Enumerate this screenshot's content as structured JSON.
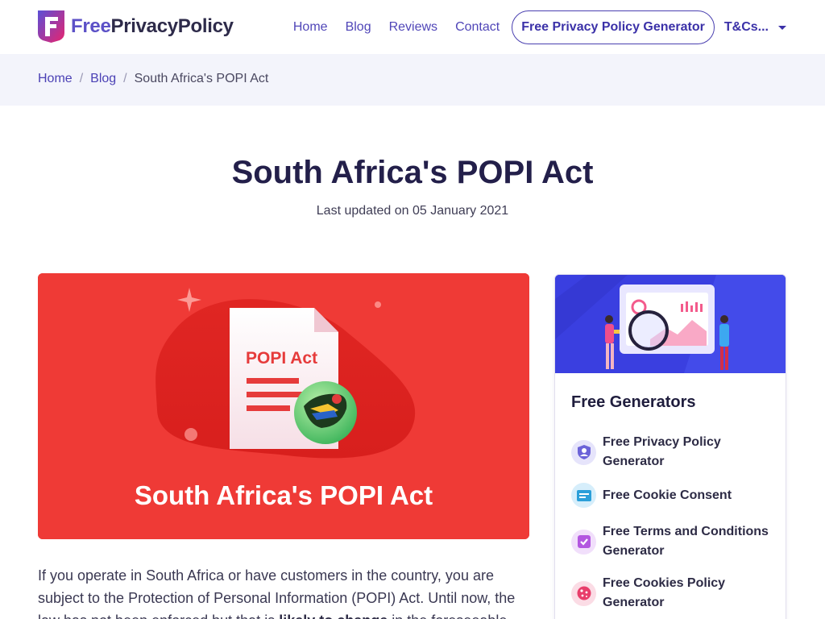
{
  "header": {
    "logo_free": "Free",
    "logo_rest": "PrivacyPolicy",
    "nav": [
      {
        "label": "Home"
      },
      {
        "label": "Blog"
      },
      {
        "label": "Reviews"
      },
      {
        "label": "Contact"
      }
    ],
    "cta_label": "Free Privacy Policy Generator",
    "dropdown_label": "T&Cs..."
  },
  "breadcrumb": {
    "home": "Home",
    "blog": "Blog",
    "current": "South Africa's POPI Act"
  },
  "article": {
    "title": "South Africa's POPI Act",
    "updated": "Last updated on 05 January 2021",
    "hero_doc_title": "POPI Act",
    "hero_caption": "South Africa's POPI Act",
    "intro_1": "If you operate in South Africa or have customers in the country, you are subject to the Protection of Personal Information (POPI) Act. Until now, the law has not been enforced but that is ",
    "intro_bold": "likely to change",
    "intro_2": " in the foreseeable"
  },
  "sidebar": {
    "title": "Free Generators",
    "items": [
      {
        "label": "Free Privacy Policy Generator",
        "icon": "shield-user-icon",
        "color": "#6c63d8"
      },
      {
        "label": "Free Cookie Consent",
        "icon": "cookie-banner-icon",
        "color": "#2b9fd9"
      },
      {
        "label": "Free Terms and Conditions Generator",
        "icon": "checkbox-icon",
        "color": "#b357e0"
      },
      {
        "label": "Free Cookies Policy Generator",
        "icon": "cookie-icon",
        "color": "#e83e6b"
      }
    ]
  },
  "colors": {
    "brand": "#5c51c7",
    "hero_red": "#ef3a36",
    "breadcrumb_bg": "#f3f4fb"
  }
}
